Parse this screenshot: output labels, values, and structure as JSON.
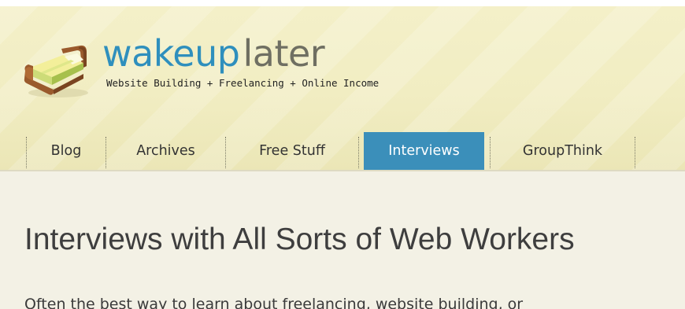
{
  "brand": {
    "name_part1": "wakeup",
    "name_part2": "later",
    "tagline": "Website Building + Freelancing + Online Income",
    "logo_icon": "bed-icon",
    "colors": {
      "accent": "#2f8fbd",
      "secondary": "#6f6f62"
    }
  },
  "nav": {
    "items": [
      {
        "label": "Blog",
        "active": false
      },
      {
        "label": "Archives",
        "active": false
      },
      {
        "label": "Free Stuff",
        "active": false
      },
      {
        "label": "Interviews",
        "active": true
      },
      {
        "label": "GroupThink",
        "active": false
      }
    ],
    "active_color": "#3b8fba"
  },
  "main": {
    "title": "Interviews with All Sorts of Web Workers",
    "intro": "Often the best way to learn about freelancing, website building, or"
  }
}
